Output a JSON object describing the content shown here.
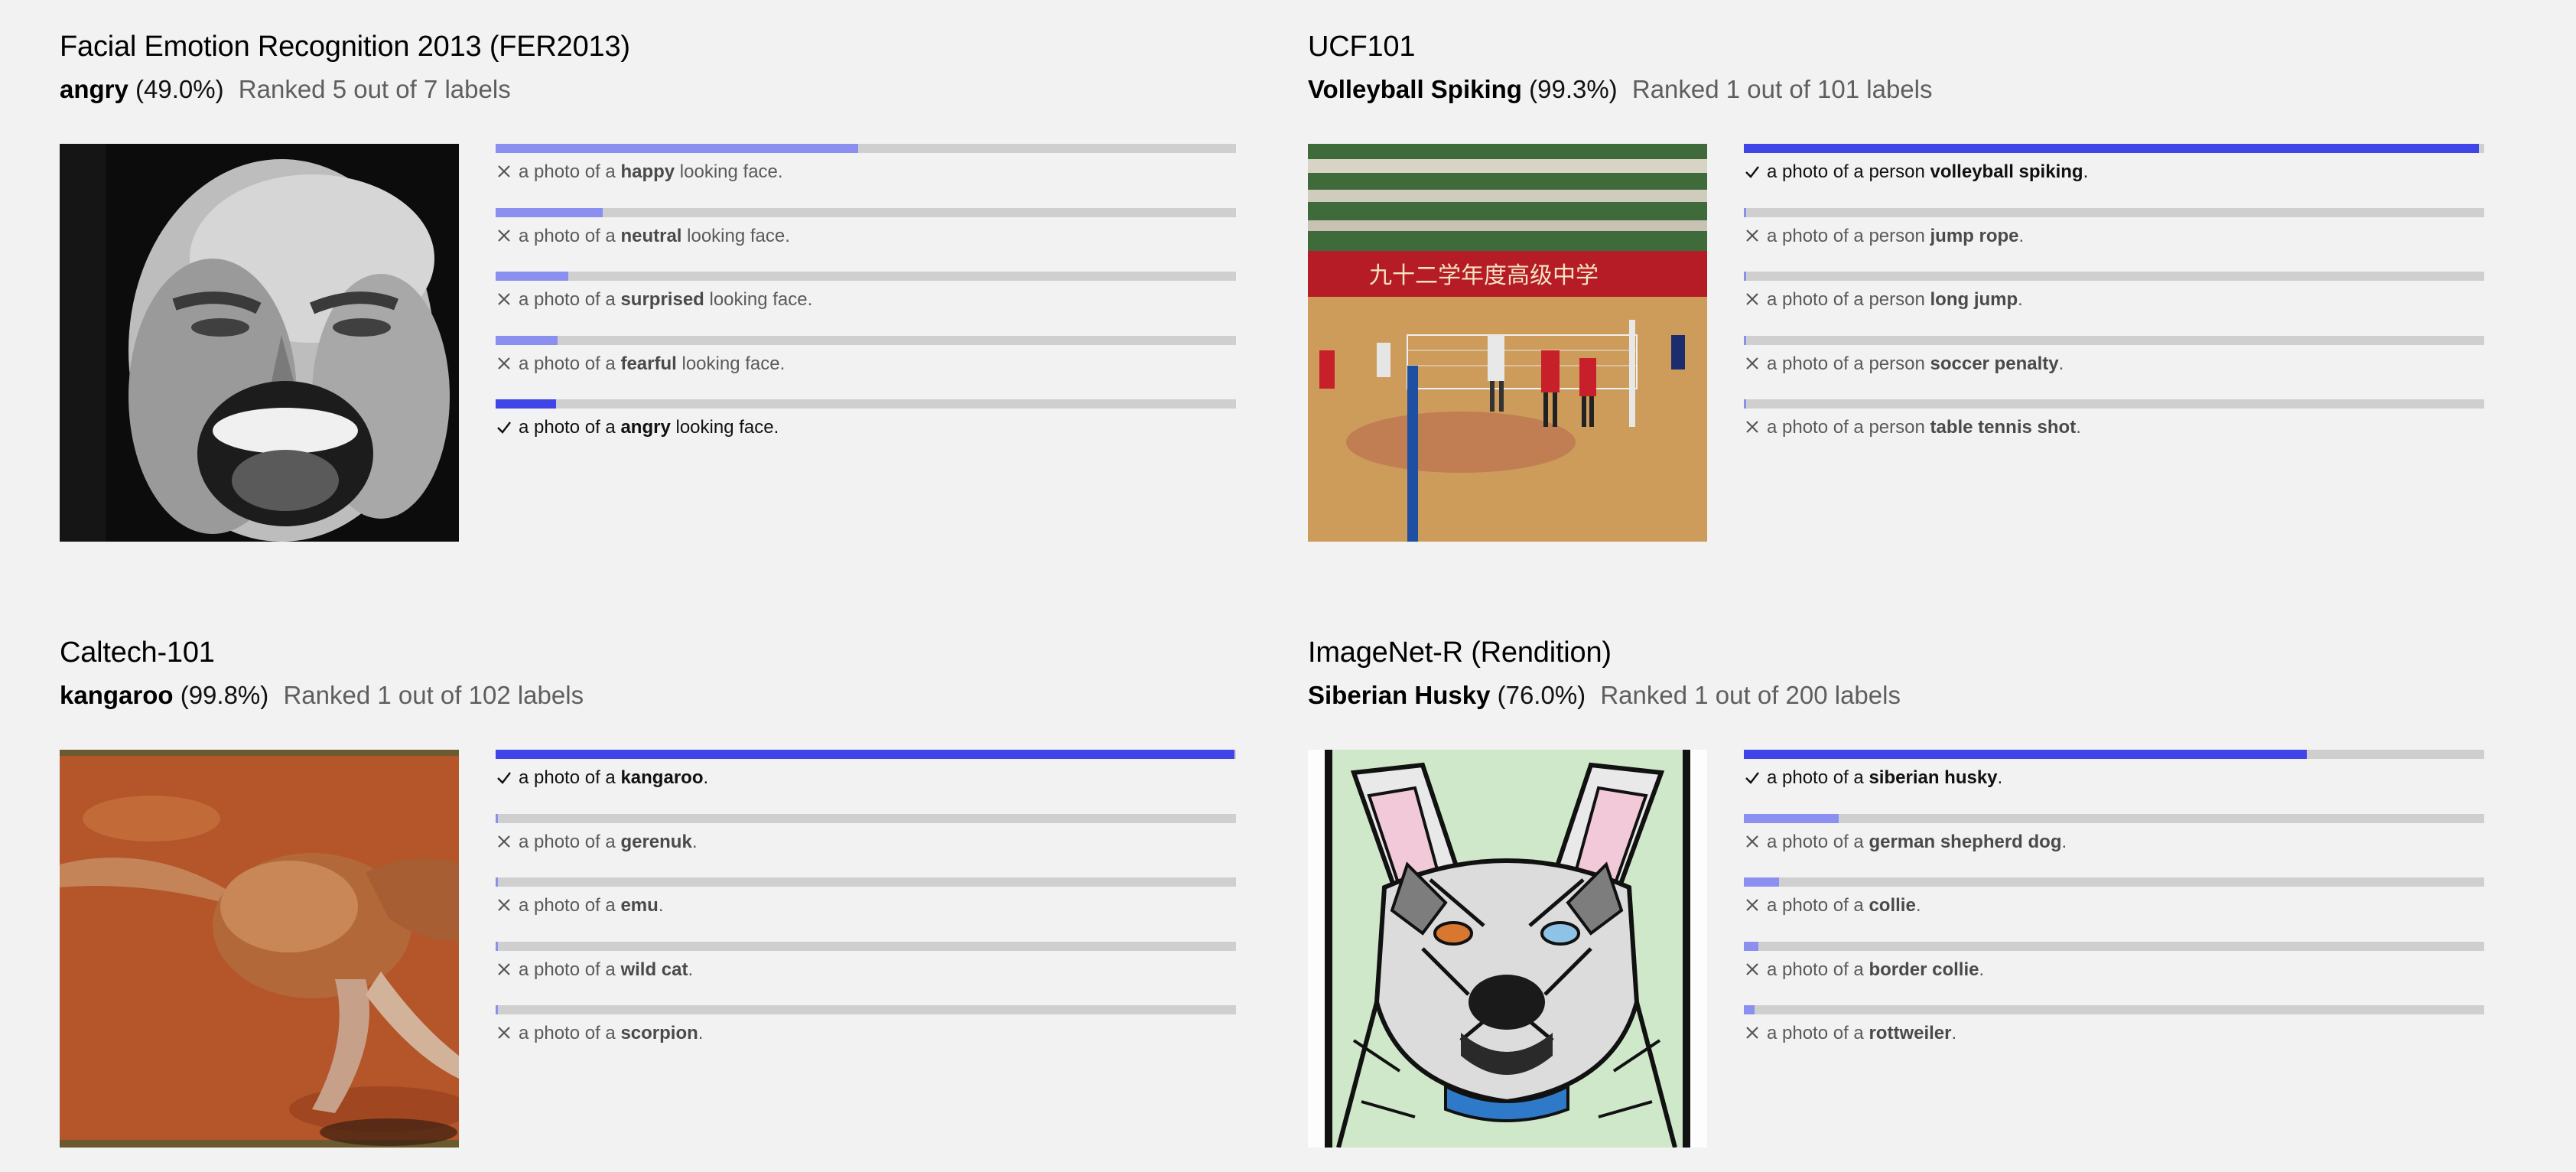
{
  "panels": [
    {
      "title": "Facial Emotion Recognition 2013 (FER2013)",
      "top_label": "angry",
      "top_pct": "(49.0%)",
      "rank": "Ranked 5 out of 7 labels",
      "image": "grayscale screaming face",
      "rows": [
        {
          "prefix": "a photo of a ",
          "label": "happy",
          "suffix": " looking face.",
          "score": 0.49,
          "correct": false
        },
        {
          "prefix": "a photo of a ",
          "label": "neutral",
          "suffix": " looking face.",
          "score": 0.145,
          "correct": false
        },
        {
          "prefix": "a photo of a ",
          "label": "surprised",
          "suffix": " looking face.",
          "score": 0.098,
          "correct": false
        },
        {
          "prefix": "a photo of a ",
          "label": "fearful",
          "suffix": " looking face.",
          "score": 0.084,
          "correct": false
        },
        {
          "prefix": "a photo of a ",
          "label": "angry",
          "suffix": " looking face.",
          "score": 0.082,
          "correct": true
        }
      ]
    },
    {
      "title": "UCF101",
      "top_label": "Volleyball Spiking",
      "top_pct": "(99.3%)",
      "rank": "Ranked 1 out of 101 labels",
      "image": "volleyball players in gym",
      "rows": [
        {
          "prefix": "a photo of a person ",
          "label": "volleyball spiking",
          "suffix": ".",
          "score": 0.993,
          "correct": true
        },
        {
          "prefix": "a photo of a person ",
          "label": "jump rope",
          "suffix": ".",
          "score": 0.001,
          "correct": false
        },
        {
          "prefix": "a photo of a person ",
          "label": "long jump",
          "suffix": ".",
          "score": 0.001,
          "correct": false
        },
        {
          "prefix": "a photo of a person ",
          "label": "soccer penalty",
          "suffix": ".",
          "score": 0.001,
          "correct": false
        },
        {
          "prefix": "a photo of a person ",
          "label": "table tennis shot",
          "suffix": ".",
          "score": 0.001,
          "correct": false
        }
      ]
    },
    {
      "title": "Caltech-101",
      "top_label": "kangaroo",
      "top_pct": "(99.8%)",
      "rank": "Ranked 1 out of 102 labels",
      "image": "kangaroo on red dirt",
      "rows": [
        {
          "prefix": "a photo of a ",
          "label": "kangaroo",
          "suffix": ".",
          "score": 0.998,
          "correct": true
        },
        {
          "prefix": "a photo of a ",
          "label": "gerenuk",
          "suffix": ".",
          "score": 0.002,
          "correct": false
        },
        {
          "prefix": "a photo of a ",
          "label": "emu",
          "suffix": ".",
          "score": 0.001,
          "correct": false
        },
        {
          "prefix": "a photo of a ",
          "label": "wild cat",
          "suffix": ".",
          "score": 0.001,
          "correct": false
        },
        {
          "prefix": "a photo of a ",
          "label": "scorpion",
          "suffix": ".",
          "score": 0.001,
          "correct": false
        }
      ]
    },
    {
      "title": "ImageNet-R (Rendition)",
      "top_label": "Siberian Husky",
      "top_pct": "(76.0%)",
      "rank": "Ranked 1 out of 200 labels",
      "image": "stained glass husky drawing",
      "rows": [
        {
          "prefix": "a photo of a ",
          "label": "siberian husky",
          "suffix": ".",
          "score": 0.76,
          "correct": true
        },
        {
          "prefix": "a photo of a ",
          "label": "german shepherd dog",
          "suffix": ".",
          "score": 0.128,
          "correct": false
        },
        {
          "prefix": "a photo of a ",
          "label": "collie",
          "suffix": ".",
          "score": 0.048,
          "correct": false
        },
        {
          "prefix": "a photo of a ",
          "label": "border collie",
          "suffix": ".",
          "score": 0.02,
          "correct": false
        },
        {
          "prefix": "a photo of a ",
          "label": "rottweiler",
          "suffix": ".",
          "score": 0.014,
          "correct": false
        }
      ]
    }
  ],
  "colors": {
    "background": "#f2f2f2",
    "track": "#cfcfcf",
    "fill_correct": "#3f45e6",
    "fill_incorrect": "#8b8ff0",
    "text_muted": "#5e5e5e"
  },
  "icons": {
    "correct": "check-icon",
    "incorrect": "cross-icon"
  }
}
